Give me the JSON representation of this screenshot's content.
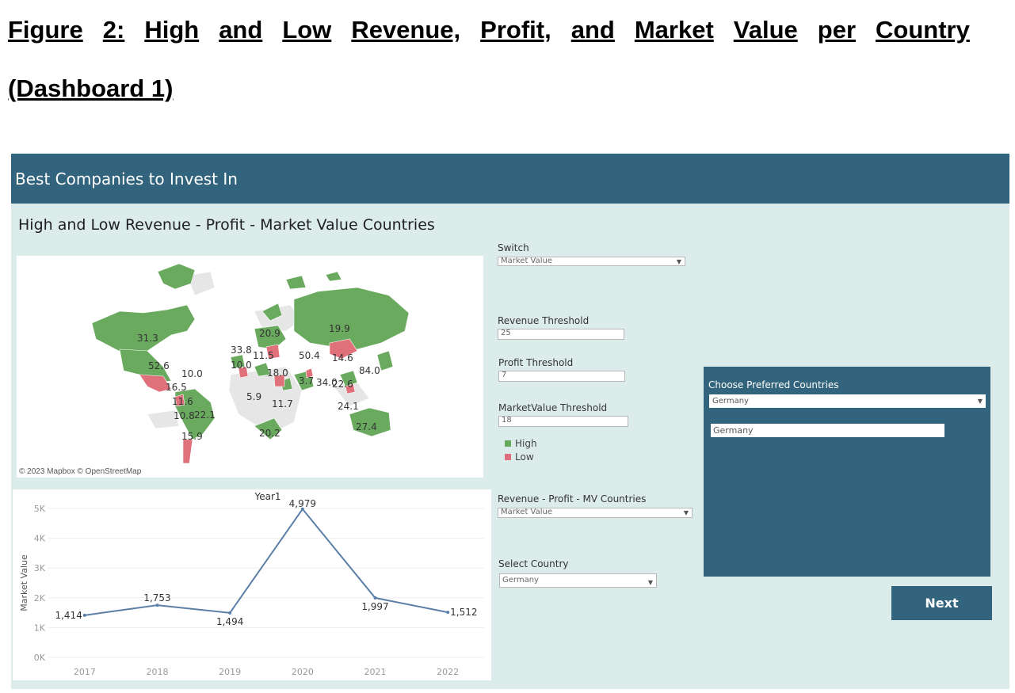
{
  "figure": {
    "title_line1_words": [
      "Figure",
      "2:",
      "High",
      "and",
      "Low",
      "Revenue,",
      "Profit,",
      "and",
      "Market",
      "Value",
      "per",
      "Country"
    ],
    "title_line2": "(Dashboard 1)"
  },
  "dashboard": {
    "header_title": "Best Companies to Invest In",
    "section_title": "High and Low Revenue - Profit - Market Value Countries",
    "map": {
      "attribution": "© 2023 Mapbox © OpenStreetMap",
      "labels": [
        "31.3",
        "52.6",
        "10.0",
        "16.5",
        "11.6",
        "10.8",
        "22.1",
        "15.9",
        "33.8",
        "10.0",
        "11.5",
        "20.9",
        "50.4",
        "14.6",
        "19.9",
        "84.0",
        "18.0",
        "3.7",
        "34.0",
        "22.6",
        "24.1",
        "5.9",
        "11.7",
        "20.2",
        "27.4"
      ],
      "colors": {
        "high": "#6aaa5e",
        "low": "#e0707a",
        "no_data": "#e6e6e6"
      }
    },
    "controls": {
      "switch": {
        "label": "Switch",
        "value": "Market Value"
      },
      "revenue_threshold": {
        "label": "Revenue Threshold",
        "value": "25"
      },
      "profit_threshold": {
        "label": "Profit Threshold",
        "value": "7"
      },
      "marketvalue_threshold": {
        "label": "MarketValue Threshold",
        "value": "18"
      },
      "legend": {
        "high": "High",
        "low": "Low"
      },
      "rpm_countries": {
        "label": "Revenue - Profit - MV Countries",
        "value": "Market Value"
      },
      "select_country": {
        "label": "Select Country",
        "value": "Germany"
      }
    },
    "preferred": {
      "title": "Choose Preferred Countries",
      "dropdown_value": "Germany",
      "input_value": "Germany"
    },
    "next_button": "Next"
  },
  "chart_data": {
    "type": "line",
    "title": "Year1",
    "xlabel": "",
    "ylabel": "Market Value",
    "categories": [
      "2017",
      "2018",
      "2019",
      "2020",
      "2021",
      "2022"
    ],
    "values": [
      1414,
      1753,
      1494,
      4979,
      1997,
      1512
    ],
    "value_labels": [
      "1,414",
      "1,753",
      "1,494",
      "4,979",
      "1,997",
      "1,512"
    ],
    "y_ticks": [
      0,
      1000,
      2000,
      3000,
      4000,
      5000
    ],
    "y_tick_labels": [
      "0K",
      "1K",
      "2K",
      "3K",
      "4K",
      "5K"
    ],
    "ylim": [
      0,
      5000
    ],
    "grid": true,
    "line_color": "#5b7fa6"
  }
}
